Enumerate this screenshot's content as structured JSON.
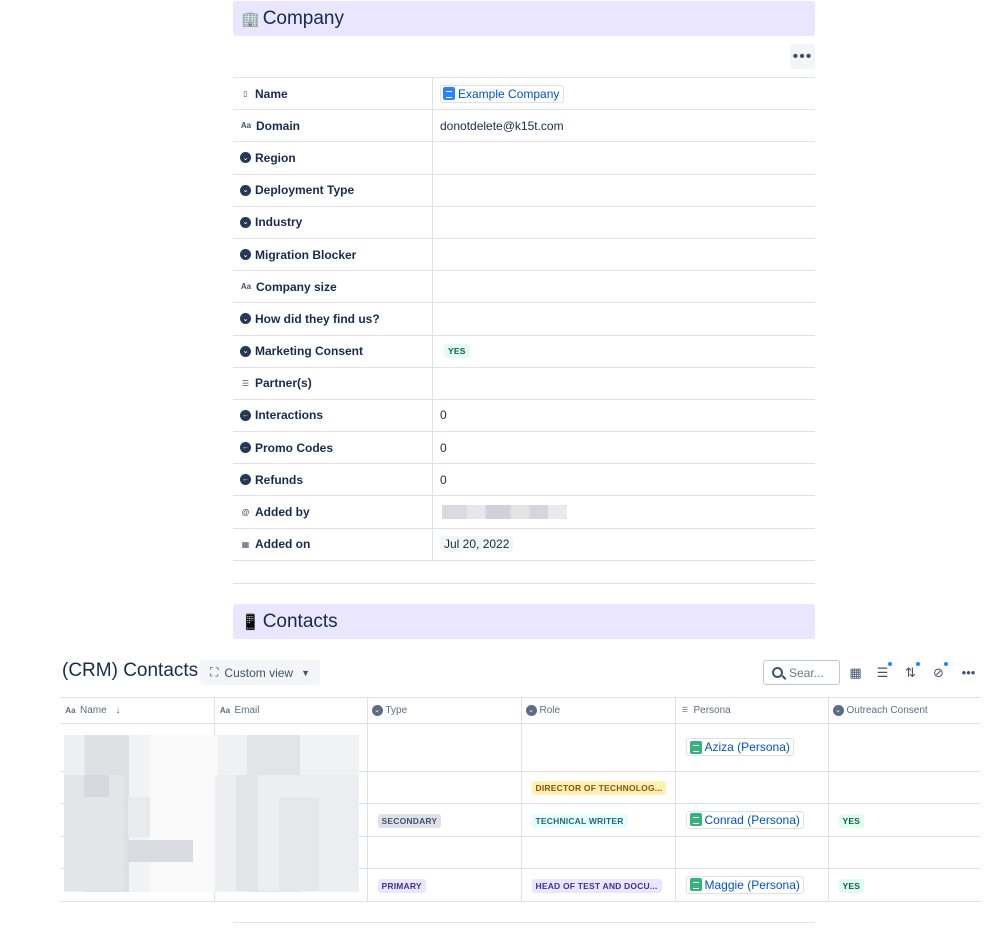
{
  "company_section": {
    "emoji": "🏢",
    "title": "Company",
    "more_label": "•••"
  },
  "properties": [
    {
      "icon": "page-icon",
      "label": "Name",
      "value": "Example Company",
      "kind": "page"
    },
    {
      "icon": "text-icon",
      "label": "Domain",
      "value": "donotdelete@k15t.com",
      "kind": "text"
    },
    {
      "icon": "select-icon",
      "label": "Region",
      "value": "",
      "kind": "text"
    },
    {
      "icon": "select-icon",
      "label": "Deployment Type",
      "value": "",
      "kind": "text"
    },
    {
      "icon": "select-icon",
      "label": "Industry",
      "value": "",
      "kind": "text"
    },
    {
      "icon": "select-icon",
      "label": "Migration Blocker",
      "value": "",
      "kind": "text"
    },
    {
      "icon": "text-icon",
      "label": "Company size",
      "value": "",
      "kind": "text"
    },
    {
      "icon": "select-icon",
      "label": "How did they find us?",
      "value": "",
      "kind": "text"
    },
    {
      "icon": "select-icon",
      "label": "Marketing Consent",
      "value": "YES",
      "kind": "lozenge"
    },
    {
      "icon": "relation-icon",
      "label": "Partner(s)",
      "value": "",
      "kind": "text"
    },
    {
      "icon": "rollup-icon",
      "label": "Interactions",
      "value": "0",
      "kind": "text"
    },
    {
      "icon": "rollup-icon",
      "label": "Promo Codes",
      "value": "0",
      "kind": "text"
    },
    {
      "icon": "rollup-icon",
      "label": "Refunds",
      "value": "0",
      "kind": "text"
    },
    {
      "icon": "user-icon",
      "label": "Added by",
      "value": "",
      "kind": "blurred"
    },
    {
      "icon": "calendar-icon",
      "label": "Added on",
      "value": "Jul 20, 2022",
      "kind": "date"
    }
  ],
  "contacts_section": {
    "emoji": "📱",
    "title": "Contacts"
  },
  "database": {
    "title": "(CRM) Contacts",
    "view_label": "Custom view",
    "search_placeholder": "Sear...",
    "columns": [
      {
        "icon": "text-icon",
        "label": "Name"
      },
      {
        "icon": "text-icon",
        "label": "Email"
      },
      {
        "icon": "select-icon",
        "label": "Type"
      },
      {
        "icon": "select-icon",
        "label": "Role"
      },
      {
        "icon": "relation-icon",
        "label": "Persona"
      },
      {
        "icon": "select-icon",
        "label": "Outreach Consent"
      }
    ],
    "rows": [
      {
        "type": "",
        "role": "",
        "persona": "Aziza (Persona)",
        "consent": ""
      },
      {
        "type": "",
        "role": "DIRECTOR OF TECHNOLOG...",
        "persona": "",
        "consent": ""
      },
      {
        "type": "SECONDARY",
        "role": "TECHNICAL WRITER",
        "persona": "Conrad (Persona)",
        "consent": "YES"
      },
      {
        "type": "",
        "role": "",
        "persona": "",
        "consent": ""
      },
      {
        "type": "PRIMARY",
        "role": "HEAD OF TEST AND DOCU...",
        "persona": "Maggie (Persona)",
        "consent": "YES"
      }
    ]
  },
  "colors": {
    "section_bg": "#eae6ff",
    "link": "#0052cc",
    "lozenge_green": "#006644"
  }
}
